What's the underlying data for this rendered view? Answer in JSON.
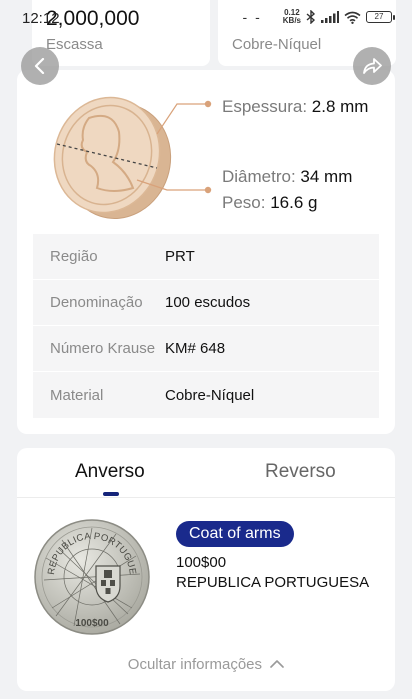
{
  "status": {
    "time": "12:12",
    "signal_text": "- -",
    "net_speed_top": "0.12",
    "net_speed_bottom": "KB/s",
    "battery": "27"
  },
  "top_cards": [
    {
      "value": "2,000,000",
      "label": "Escassa"
    },
    {
      "value": "",
      "label": "Cobre-Níquel"
    }
  ],
  "specs": {
    "thickness_label": "Espessura:",
    "thickness_value": "2.8 mm",
    "diameter_label": "Diâmetro:",
    "diameter_value": "34 mm",
    "weight_label": "Peso:",
    "weight_value": "16.6 g"
  },
  "info_rows": [
    {
      "key": "Região",
      "value": "PRT"
    },
    {
      "key": "Denominação",
      "value": "100 escudos"
    },
    {
      "key": "Número Krause",
      "value": "KM# 648"
    },
    {
      "key": "Material",
      "value": "Cobre-Níquel"
    }
  ],
  "tabs": {
    "obverse": "Anverso",
    "reverse": "Reverso"
  },
  "obverse": {
    "badge": "Coat of arms",
    "line1": "100$00",
    "line2": "REPUBLICA PORTUGUESA",
    "coin_top_text": "REPUBLICA PORTUGUESA",
    "coin_bottom_text": "100$00"
  },
  "hide_info": "Ocultar informações"
}
